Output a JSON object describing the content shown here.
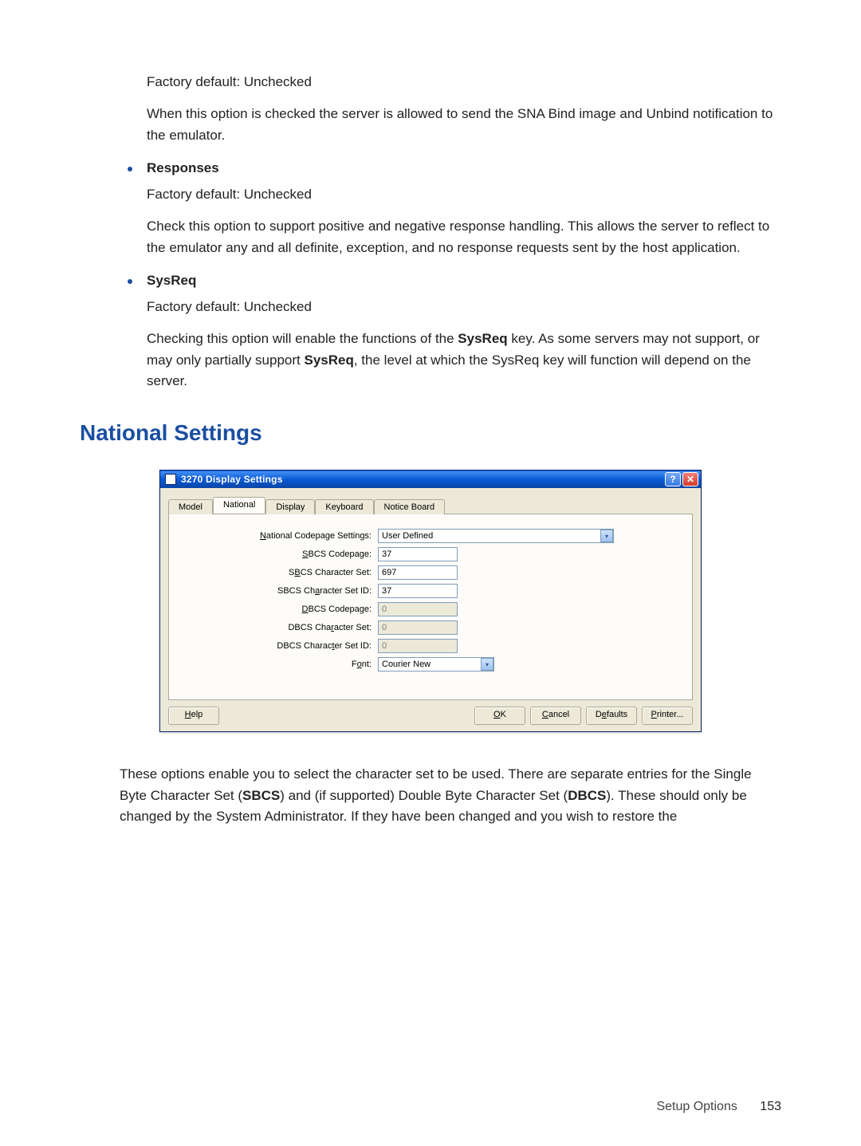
{
  "intro": {
    "factory_default": "Factory default: Unchecked",
    "intro_para": "When this option is checked the server is allowed to send the SNA Bind image and Unbind notification to the emulator."
  },
  "responses": {
    "title": "Responses",
    "factory_default": "Factory default: Unchecked",
    "para": "Check this option to support positive and negative response handling. This allows the server to reflect to the emulator any and all definite, exception, and no response requests sent by the host application."
  },
  "sysreq": {
    "title": "SysReq",
    "factory_default": "Factory default: Unchecked",
    "para_pre": "Checking this option will enable the functions of the ",
    "para_bold1": "SysReq",
    "para_mid": " key. As some servers may not support, or may only partially support ",
    "para_bold2": "SysReq",
    "para_post": ", the level at which the SysReq key will function will depend on the server."
  },
  "heading": "National Settings",
  "dialog": {
    "title": "3270 Display Settings",
    "tabs": [
      "Model",
      "National",
      "Display",
      "Keyboard",
      "Notice Board"
    ],
    "active_tab": 1,
    "labels": {
      "ncp": "National Codepage Settings:",
      "sbcs_cp": "SBCS Codepage:",
      "sbcs_cs": "SBCS Character Set:",
      "sbcs_id": "SBCS Character Set ID:",
      "dbcs_cp": "DBCS Codepage:",
      "dbcs_cs": "DBCS Character Set:",
      "dbcs_id": "DBCS Character Set ID:",
      "font": "Font:"
    },
    "values": {
      "ncp": "User Defined",
      "sbcs_cp": "37",
      "sbcs_cs": "697",
      "sbcs_id": "37",
      "dbcs_cp": "0",
      "dbcs_cs": "0",
      "dbcs_id": "0",
      "font": "Courier New"
    },
    "buttons": {
      "help": "Help",
      "ok": "OK",
      "cancel": "Cancel",
      "defaults": "Defaults",
      "printer": "Printer..."
    }
  },
  "after_para": {
    "t1": "These options enable you to select the character set to be used. There are separate entries for the Single Byte Character Set (",
    "b1": "SBCS",
    "t2": ") and (if supported) Double Byte Character Set (",
    "b2": "DBCS",
    "t3": "). These should only be changed by the System Administrator. If they have been changed and you wish to restore the"
  },
  "footer": {
    "section": "Setup Options",
    "page": "153"
  }
}
